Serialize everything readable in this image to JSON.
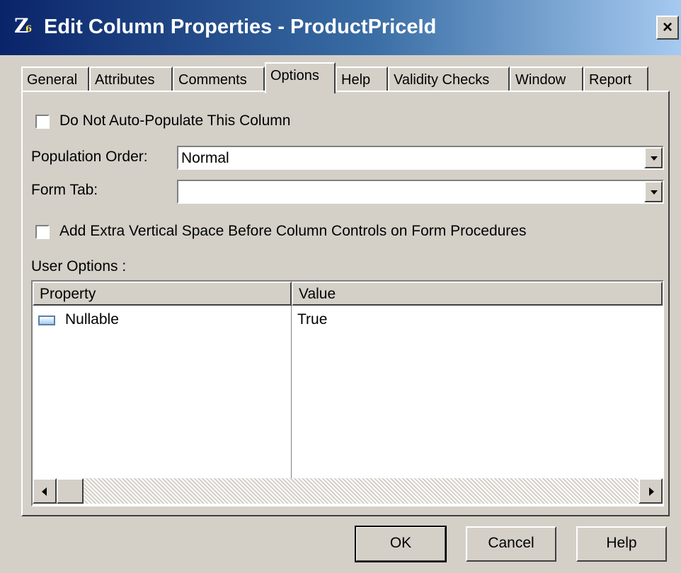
{
  "window": {
    "title": "Edit Column Properties - ProductPriceId",
    "close_label": "×",
    "icon_glyph": "Z",
    "icon_sub": "6"
  },
  "tabs": [
    {
      "label": "General",
      "active": false
    },
    {
      "label": "Attributes",
      "active": false
    },
    {
      "label": "Comments",
      "active": false
    },
    {
      "label": "Options",
      "active": true
    },
    {
      "label": "Help",
      "active": false
    },
    {
      "label": "Validity Checks",
      "active": false
    },
    {
      "label": "Window",
      "active": false
    },
    {
      "label": "Report",
      "active": false
    }
  ],
  "options": {
    "no_auto_populate_label": "Do Not Auto-Populate This Column",
    "no_auto_populate_checked": false,
    "population_order_label": "Population Order:",
    "population_order_value": "Normal",
    "form_tab_label": "Form Tab:",
    "form_tab_value": "",
    "extra_space_label": "Add Extra Vertical Space Before Column Controls on Form Procedures",
    "extra_space_checked": false,
    "user_options_label": "User Options :"
  },
  "user_options": {
    "columns": [
      "Property",
      "Value"
    ],
    "rows": [
      {
        "property": "Nullable",
        "value": "True",
        "icon": "list-item-icon"
      }
    ]
  },
  "buttons": {
    "ok": "OK",
    "cancel": "Cancel",
    "help": "Help"
  },
  "colors": {
    "dialog_bg": "#d4d0c8",
    "title_start": "#0a246a",
    "title_end": "#a6caf0"
  }
}
